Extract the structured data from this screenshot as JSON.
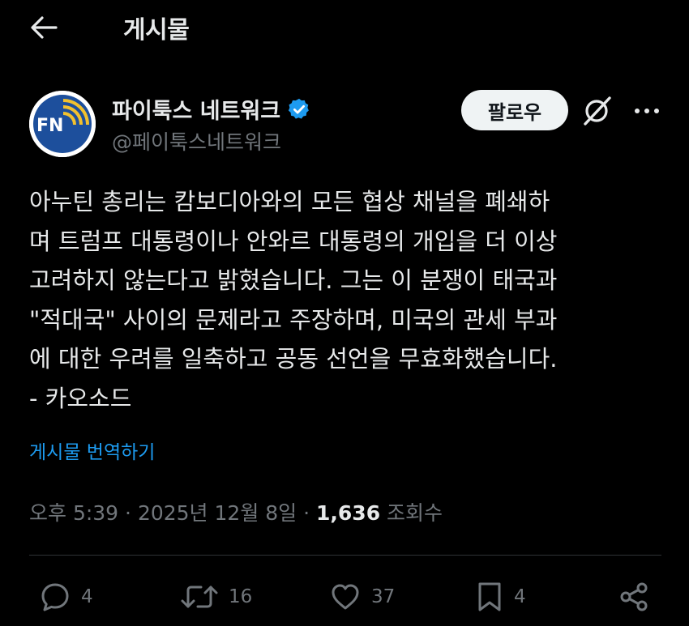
{
  "header": {
    "title": "게시물"
  },
  "author": {
    "name": "파이툭스 네트워크",
    "handle": "@페이툭스네트워크",
    "avatar_text": "FN"
  },
  "follow_button": "팔로우",
  "post": {
    "lines": [
      "아누틴 총리는 캄보디아와의 모든 협상 채널을 폐쇄하",
      "며 트럼프 대통령이나 안와르 대통령의 개입을 더 이상",
      "고려하지 않는다고 밝혔습니다. 그는 이 분쟁이 태국과",
      "\"적대국\" 사이의 문제라고 주장하며, 미국의 관세 부과",
      "에 대한 우려를 일축하고 공동 선언을 무효화했습니다.",
      "- 카오소드"
    ],
    "translate_label": "게시물 번역하기"
  },
  "meta": {
    "time": "오후 5:39",
    "separator": " · ",
    "date": "2025년 12월 8일",
    "views_count": "1,636",
    "views_label": " 조회수"
  },
  "actions": {
    "reply_count": "4",
    "repost_count": "16",
    "like_count": "37",
    "bookmark_count": "4"
  },
  "colors": {
    "background": "#000000",
    "text": "#e7e9ea",
    "muted": "#71767b",
    "link": "#1d9bf0",
    "verified": "#1d9bf0"
  }
}
